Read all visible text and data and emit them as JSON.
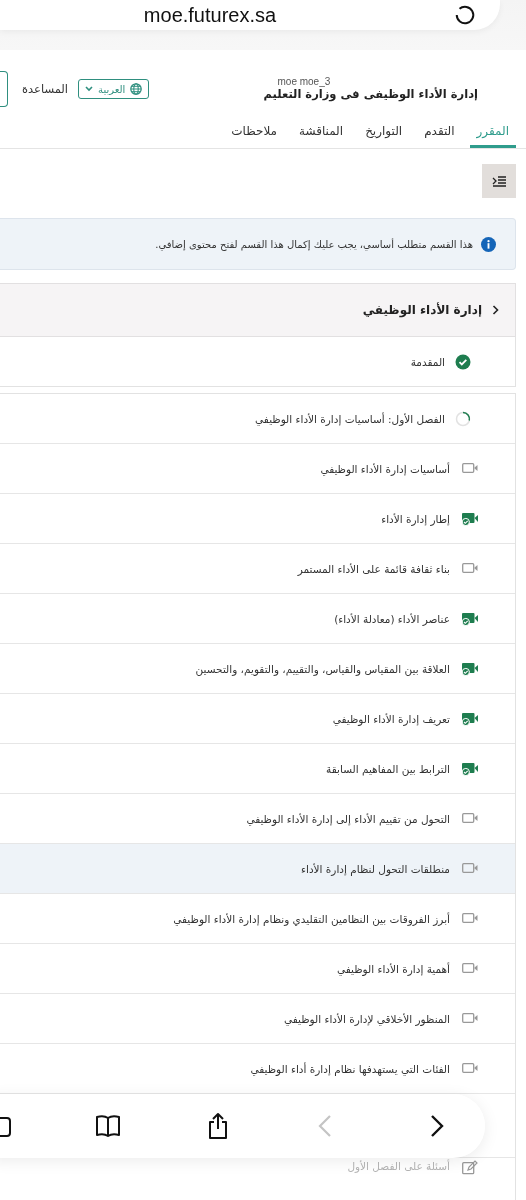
{
  "browser": {
    "url": "moe.futurex.sa"
  },
  "header": {
    "user": "moe moe_3",
    "course_title": "إدارة الأداء الوظيفى فى وزارة التعليم",
    "language": "العربية",
    "help": "المساعدة"
  },
  "tabs": [
    {
      "label": "المقرر",
      "selected": true
    },
    {
      "label": "التقدم",
      "selected": false
    },
    {
      "label": "التواريخ",
      "selected": false
    },
    {
      "label": "المناقشة",
      "selected": false
    },
    {
      "label": "ملاحظات",
      "selected": false
    }
  ],
  "alert": {
    "text": "هذا القسم متطلب أساسي، يجب عليك إكمال هذا القسم لفتح محتوى إضافي."
  },
  "section": {
    "title": "إدارة الأداء الوظيفي"
  },
  "outline": [
    {
      "title": "المقدمة",
      "completed": true,
      "selected": false
    },
    {
      "title": "الفصل الأول: أساسيات إدارة الأداء الوظيفي",
      "completed": false,
      "selected": false,
      "children": [
        {
          "title": "أساسيات إدارة الأداء الوظيفي",
          "kind": "video",
          "completed": false,
          "selected": false
        },
        {
          "title": "إطار إدارة الأداء",
          "kind": "video",
          "completed": true,
          "selected": false
        },
        {
          "title": "بناء ثقافة قائمة على الأداء المستمر",
          "kind": "video",
          "completed": false,
          "selected": false
        },
        {
          "title": "عناصر الأداء (معادلة الأداء)",
          "kind": "video",
          "completed": true,
          "selected": false
        },
        {
          "title": "العلاقة بين المقياس والقياس، والتقييم، والتقويم، والتحسين",
          "kind": "video",
          "completed": true,
          "selected": false
        },
        {
          "title": "تعريف إدارة الأداء الوظيفي",
          "kind": "video",
          "completed": true,
          "selected": false
        },
        {
          "title": "الترابط بين المفاهيم السابقة",
          "kind": "video",
          "completed": true,
          "selected": false
        },
        {
          "title": "التحول من تقييم الأداء إلى إدارة الأداء الوظيفي",
          "kind": "video",
          "completed": false,
          "selected": false
        },
        {
          "title": "منطلقات التحول لنظام إدارة الأداء",
          "kind": "video",
          "completed": false,
          "selected": true
        },
        {
          "title": "أبرز الفروقات بين النظامين التقليدي ونظام إدارة الأداء الوظيفي",
          "kind": "video",
          "completed": false,
          "selected": false
        },
        {
          "title": "أهمية إدارة الأداء الوظيفي",
          "kind": "video",
          "completed": false,
          "selected": false
        },
        {
          "title": "المنظور الأخلاقي لإدارة الأداء الوظيفي",
          "kind": "video",
          "completed": false,
          "selected": false
        },
        {
          "title": "الفئات التي يستهدفها نظام إدارة أداء الوظيفي",
          "kind": "video",
          "completed": false,
          "selected": false
        },
        {
          "kind": "hidden"
        },
        {
          "title": "أسئلة على الفصل الأول",
          "kind": "quiz",
          "completed": false,
          "selected": false
        }
      ]
    }
  ],
  "toolbar": {
    "back": {
      "disabled": true
    },
    "forward": {
      "disabled": false
    }
  }
}
